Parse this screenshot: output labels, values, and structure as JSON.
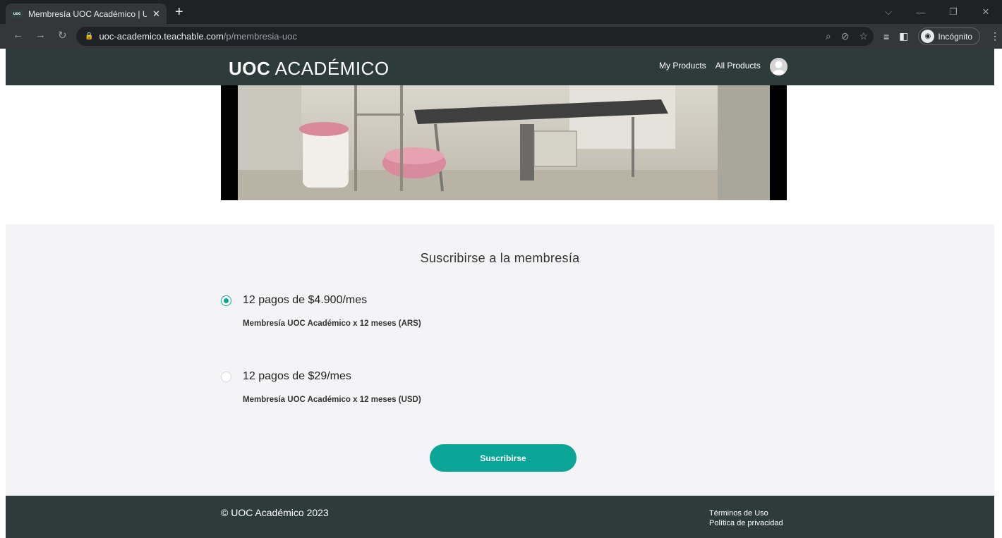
{
  "browser": {
    "tab_title": "Membresía UOC Académico | UO",
    "favicon_text": "uoc",
    "url_host": "uoc-academico.teachable.com",
    "url_path": "/p/membresia-uoc",
    "incognito_label": "Incógnito"
  },
  "header": {
    "logo_bold": "UOC",
    "logo_light": "ACADÉMICO",
    "nav": [
      {
        "label": "My Products"
      },
      {
        "label": "All Products"
      }
    ]
  },
  "membership": {
    "title": "Suscribirse a la membresía",
    "options": [
      {
        "price": "12 pagos de $4.900/mes",
        "description": "Membresía UOC Académico x 12 meses (ARS)",
        "selected": true
      },
      {
        "price": "12 pagos de $29/mes",
        "description": "Membresía UOC Académico x 12 meses (USD)",
        "selected": false
      }
    ],
    "button_label": "Suscribirse"
  },
  "footer": {
    "copyright": "© UOC Académico 2023",
    "links": [
      {
        "label": "Términos de Uso"
      },
      {
        "label": "Política de privacidad"
      }
    ]
  },
  "colors": {
    "header_bg": "#2d3c3a",
    "accent": "#0aa596",
    "section_bg": "#f4f4f6"
  }
}
